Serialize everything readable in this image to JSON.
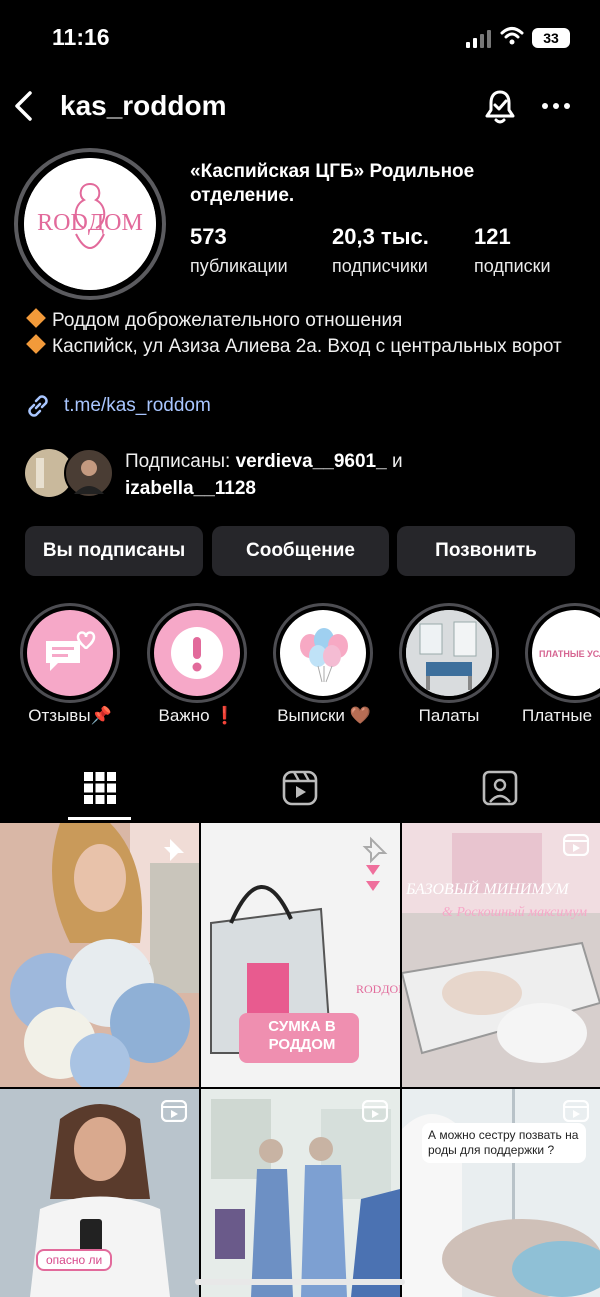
{
  "status_bar": {
    "time": "11:16",
    "battery": "33"
  },
  "header": {
    "username": "kas_roddom"
  },
  "profile": {
    "full_name": "«Каспийская ЦГБ» Родильное отделение.",
    "avatar_logo_text": "RODДОМ",
    "stats": [
      {
        "value": "573",
        "label": "публикации"
      },
      {
        "value": "20,3 тыс.",
        "label": "подписчики"
      },
      {
        "value": "121",
        "label": "подписки"
      }
    ],
    "bio": [
      "Роддом доброжелательного отношения",
      "Каспийск, ул Азиза Алиева 2а. Вход с центральных ворот"
    ],
    "link": "t.me/kas_roddom",
    "mutual": {
      "prefix": "Подписаны: ",
      "user1": "verdieva__9601_",
      "conj": " и ",
      "user2": "izabella__1128"
    }
  },
  "buttons": {
    "following": "Вы подписаны",
    "message": "Сообщение",
    "call": "Позвонить"
  },
  "highlights": [
    {
      "label": "Отзывы📌",
      "icon": "chat-heart-icon"
    },
    {
      "label": "Важно ❗",
      "icon": "exclamation-icon"
    },
    {
      "label": "Выписки 🤎",
      "icon": "balloons-icon"
    },
    {
      "label": "Палаты",
      "icon": "ward-photo"
    },
    {
      "label": "Платные",
      "icon": "paid-services-icon",
      "inner_text": "ПЛАТНЫЕ УСЛУ"
    }
  ],
  "tabs": [
    "grid-icon",
    "reels-icon",
    "tagged-icon"
  ],
  "posts": [
    {
      "type": "pinned-photo",
      "caption": ""
    },
    {
      "type": "pinned-photo",
      "caption": "СУМКА В РОДДОМ",
      "logo": "RODДОМ"
    },
    {
      "type": "reel",
      "caption": "БАЗОВЫЙ МИНИМУМ",
      "caption2": "& Роскошный максимум"
    },
    {
      "type": "reel",
      "caption": "опасно ли"
    },
    {
      "type": "reel",
      "caption": ""
    },
    {
      "type": "reel",
      "caption": "А можно сестру позвать на роды для поддержки ?"
    }
  ],
  "colors": {
    "background": "#000000",
    "button": "#26262a",
    "link": "#a9c6ff",
    "brand_pink": "#e26a9b"
  }
}
